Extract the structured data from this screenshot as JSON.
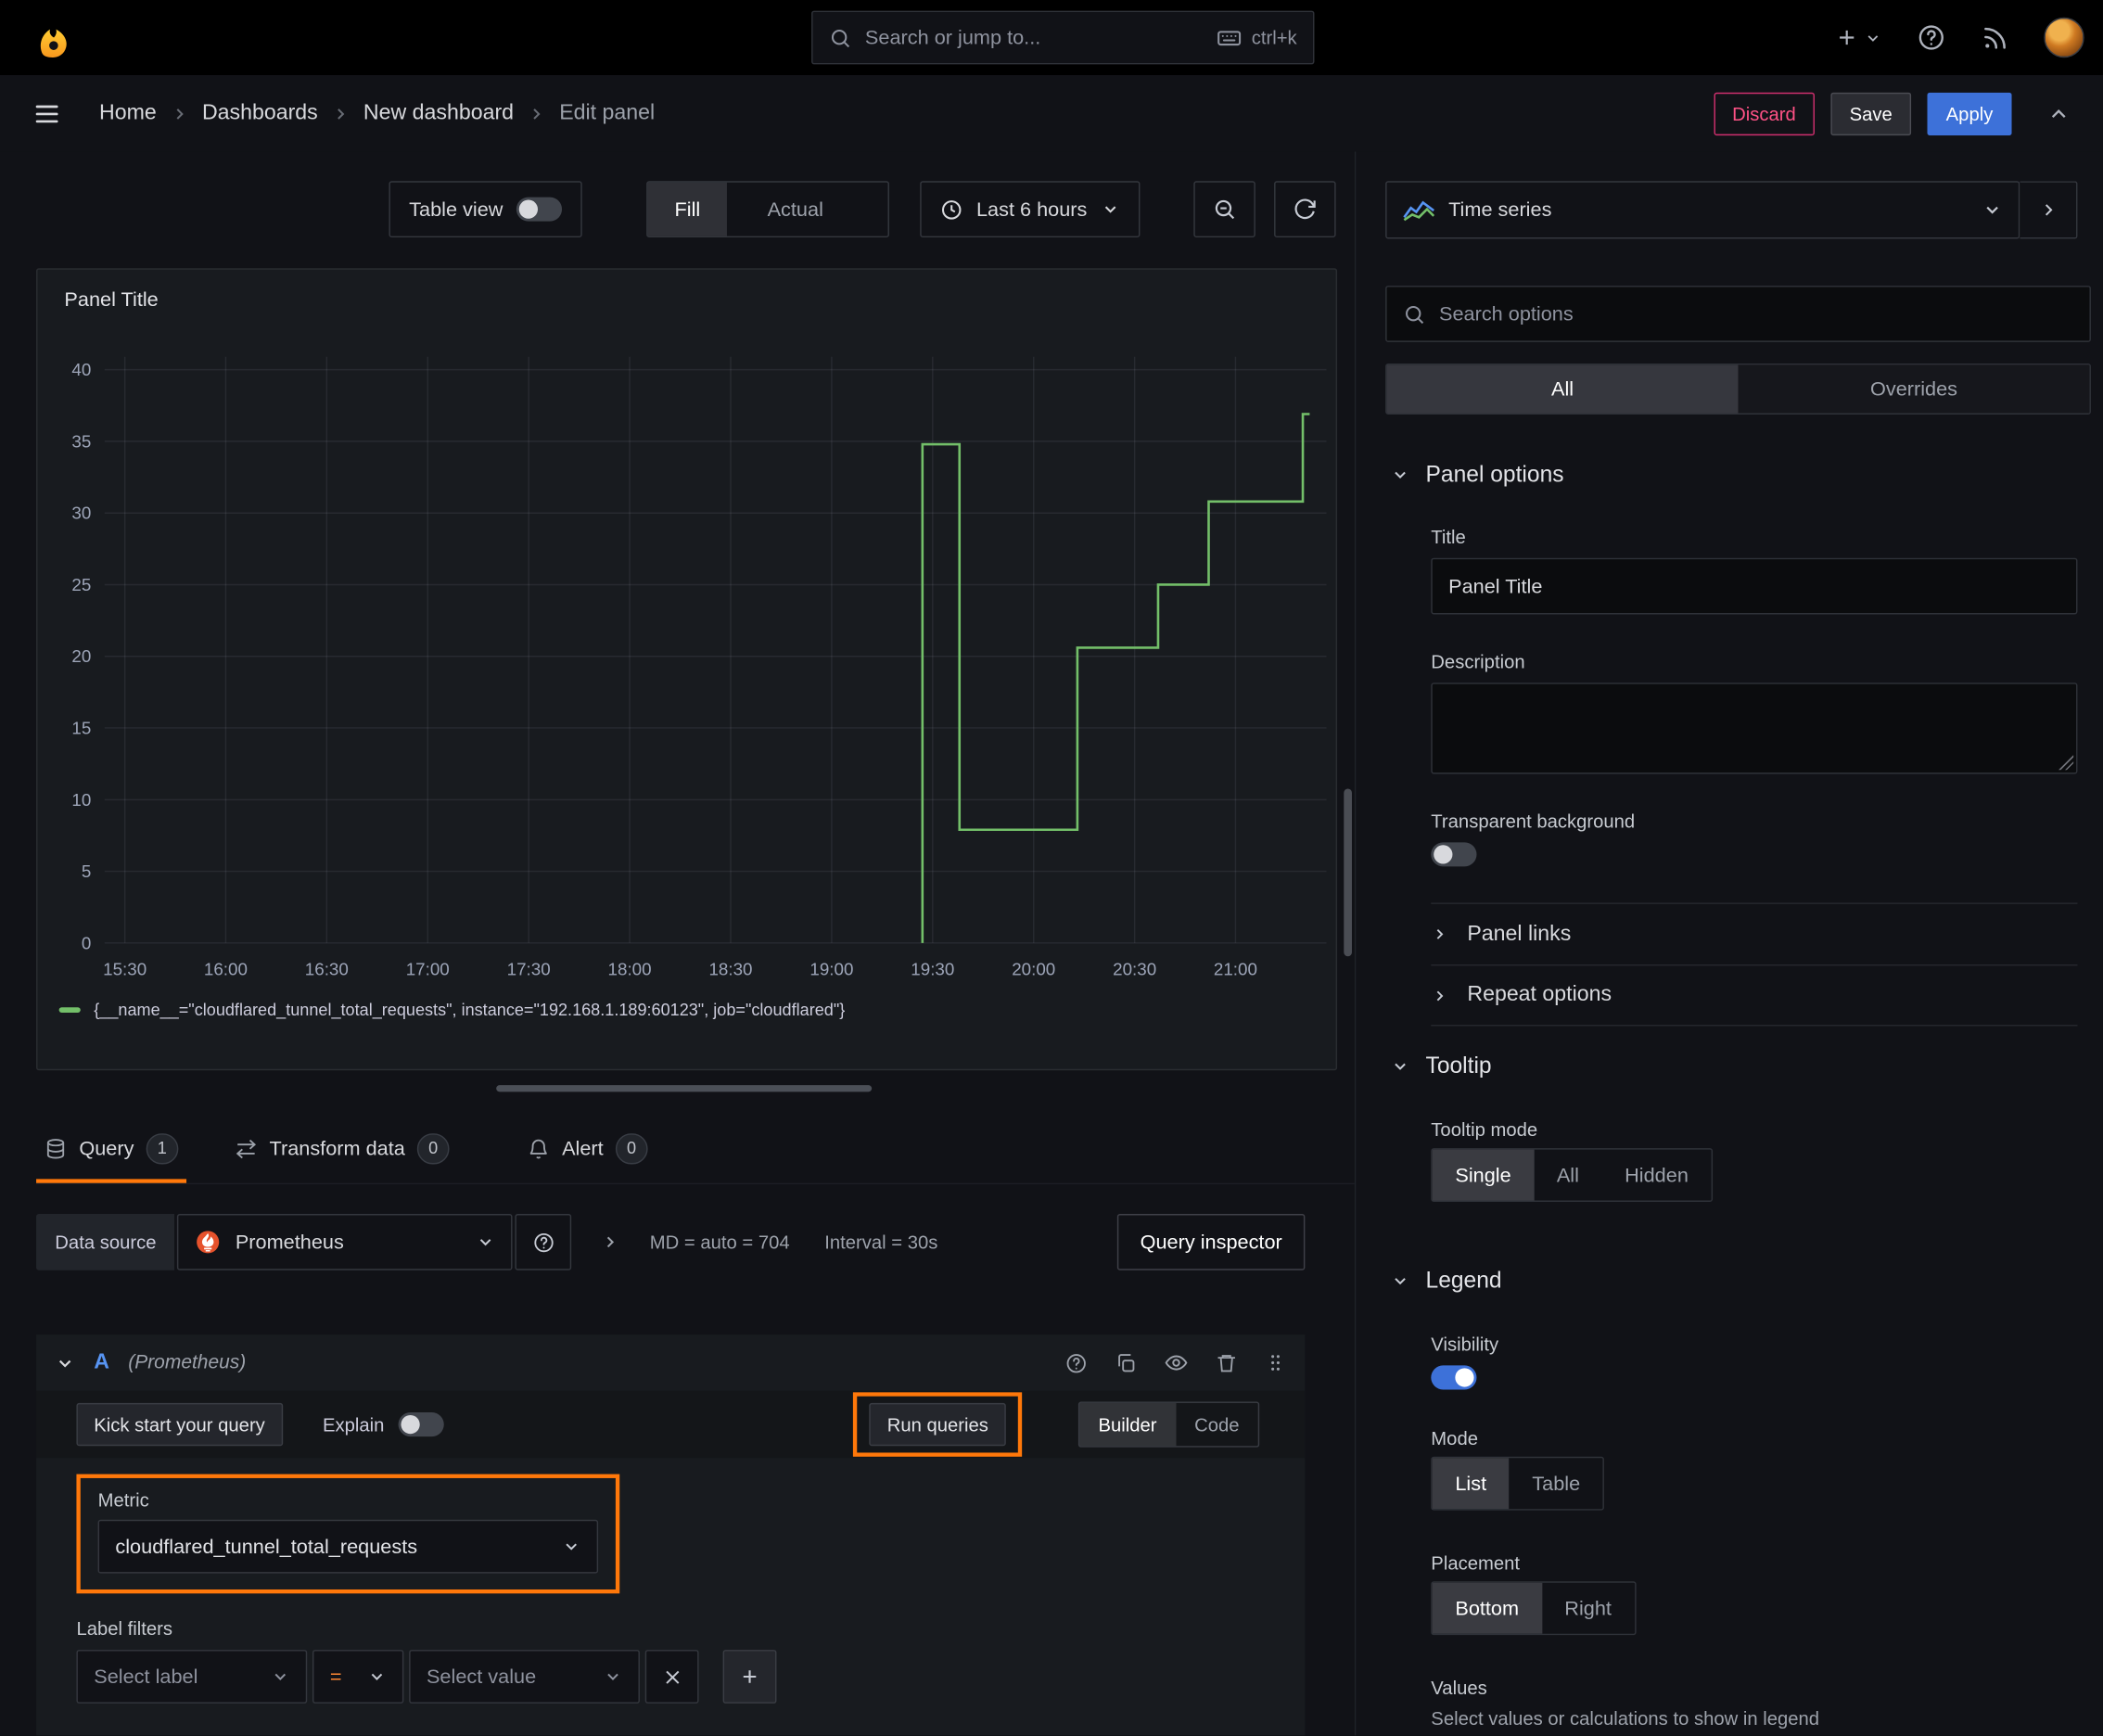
{
  "topbar": {
    "search_placeholder": "Search or jump to...",
    "shortcut": "ctrl+k"
  },
  "breadcrumb": {
    "items": [
      "Home",
      "Dashboards",
      "New dashboard",
      "Edit panel"
    ],
    "discard_label": "Discard",
    "save_label": "Save",
    "apply_label": "Apply"
  },
  "toolbar": {
    "table_view_label": "Table view",
    "fill_label": "Fill",
    "actual_label": "Actual",
    "time_range_label": "Last 6 hours"
  },
  "panel": {
    "title": "Panel Title"
  },
  "chart_data": {
    "type": "line",
    "title": "Panel Title",
    "line_style": "step",
    "grid": true,
    "legend_position": "bottom",
    "x_ticks": [
      "15:30",
      "16:00",
      "16:30",
      "17:00",
      "17:30",
      "18:00",
      "18:30",
      "19:00",
      "19:30",
      "20:00",
      "20:30",
      "21:00"
    ],
    "x_tick_minutes": [
      0,
      30,
      60,
      90,
      120,
      150,
      180,
      210,
      240,
      270,
      300,
      330
    ],
    "x_range_minutes": [
      -6,
      357
    ],
    "y_ticks": [
      0,
      5,
      10,
      15,
      20,
      25,
      30,
      35,
      40
    ],
    "ylim": [
      0,
      40.9
    ],
    "series": [
      {
        "name": "{__name__=\"cloudflared_tunnel_total_requests\", instance=\"192.168.1.189:60123\", job=\"cloudflared\"}",
        "color": "#73bf69",
        "points_min_value": [
          [
            237,
            0
          ],
          [
            237,
            34.8
          ],
          [
            248,
            34.8
          ],
          [
            248,
            7.9
          ],
          [
            283,
            7.9
          ],
          [
            283,
            20.6
          ],
          [
            307,
            20.6
          ],
          [
            307,
            25
          ],
          [
            322,
            25
          ],
          [
            322,
            30.8
          ],
          [
            350,
            30.8
          ],
          [
            350,
            36.9
          ],
          [
            352,
            36.9
          ]
        ]
      }
    ]
  },
  "tabs": {
    "query": {
      "label": "Query",
      "count": "1"
    },
    "transform": {
      "label": "Transform data",
      "count": "0"
    },
    "alert": {
      "label": "Alert",
      "count": "0"
    }
  },
  "query": {
    "datasource_label": "Data source",
    "datasource_value": "Prometheus",
    "stats_md": "MD = auto = 704",
    "stats_interval": "Interval = 30s",
    "inspector_label": "Query inspector",
    "ref_id": "A",
    "ref_ds": "(Prometheus)",
    "kickstart_label": "Kick start your query",
    "explain_label": "Explain",
    "run_label": "Run queries",
    "builder_label": "Builder",
    "code_label": "Code",
    "metric_label": "Metric",
    "metric_value": "cloudflared_tunnel_total_requests",
    "label_filters_label": "Label filters",
    "select_label_placeholder": "Select label",
    "operator_value": "=",
    "select_value_placeholder": "Select value"
  },
  "viz": {
    "name": "Time series"
  },
  "options": {
    "search_placeholder": "Search options",
    "tab_all": "All",
    "tab_overrides": "Overrides",
    "panel_options": {
      "title": "Panel options",
      "title_label": "Title",
      "title_value": "Panel Title",
      "description_label": "Description",
      "transparent_label": "Transparent background",
      "panel_links": "Panel links",
      "repeat_options": "Repeat options"
    },
    "tooltip": {
      "title": "Tooltip",
      "mode_label": "Tooltip mode",
      "modes": [
        "Single",
        "All",
        "Hidden"
      ]
    },
    "legend": {
      "title": "Legend",
      "visibility_label": "Visibility",
      "mode_label": "Mode",
      "modes": [
        "List",
        "Table"
      ],
      "placement_label": "Placement",
      "placements": [
        "Bottom",
        "Right"
      ],
      "values_label": "Values",
      "values_hint": "Select values or calculations to show in legend"
    }
  }
}
